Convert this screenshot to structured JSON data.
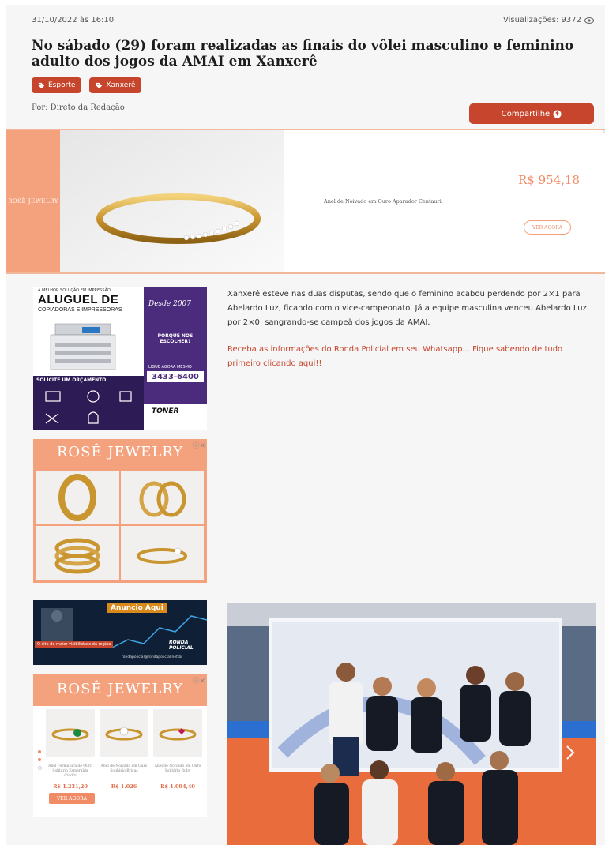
{
  "article": {
    "date": "31/10/2022 às 16:10",
    "views_label": "Visualizações: 9372",
    "title": "No sábado (29) foram realizadas as finais do vôlei masculino e feminino adulto dos jogos da AMAI em Xanxerê",
    "tags": [
      {
        "label": "Esporte",
        "icon": "tag-icon"
      },
      {
        "label": "Xanxerê",
        "icon": "tag-icon"
      }
    ],
    "author": "Por: Direto da Redação",
    "share_label": "Compartilhe",
    "paragraph_1": "Xanxerê esteve nas duas disputas, sendo que o feminino acabou perdendo por 2×1 para Abelardo Luz, ficando com o vice-campeonato. Já a equipe masculina venceu Abelardo Luz por 2×0, sangrando-se campeã dos jogos da AMAI.",
    "paragraph_2": "Receba as informações do Ronda Policial em seu Whatsapp... Fique sabendo de tudo primeiro clicando aqui!!"
  },
  "banner_ad": {
    "brand": "ROSÊ JEWELRY",
    "product": "Anel de Noivado em Ouro Aparador Centauri",
    "price": "R$ 954,18",
    "cta": "VER AGORA"
  },
  "print_ad": {
    "subtitle": "A MELHOR SOLUÇÃO EM IMPRESSÃO",
    "title": "ALUGUEL DE",
    "title2": "COPIADORAS E IMPRESSORAS",
    "since": "Desde 2007",
    "question": "PORQUE NOS ESCOLHER?",
    "call": "LIGUE AGORA MESMO",
    "phone": "3433-6400",
    "solicite": "SOLICITE UM ORÇAMENTO",
    "brand": "TONER"
  },
  "rose_ad_1": {
    "brand": "ROSÊ JEWELRY"
  },
  "anuncio_ad": {
    "label": "Anuncio Aqui",
    "site": "O site de maior visibilidade da região",
    "brand": "RONDA POLICIAL",
    "email": "rondapolicial@rondapolicial.net.br"
  },
  "rose_ad_2": {
    "brand": "ROSÊ JEWELRY",
    "items": [
      {
        "name": "Anel Formatura de Ouro Solitário Esmeralda Cinditi",
        "price": "R$ 1.231,20"
      },
      {
        "name": "Anel de Noivado em Ouro Solitário Brisus",
        "price": "R$ 1.026"
      },
      {
        "name": "Anel de Noivado em Ouro Solitário Ruby",
        "price": "R$ 1.094,40"
      }
    ],
    "cta": "VER AGORA"
  },
  "colors": {
    "accent": "#c6452c",
    "rose": "#f4a27d",
    "purple": "#4b2b7c"
  }
}
